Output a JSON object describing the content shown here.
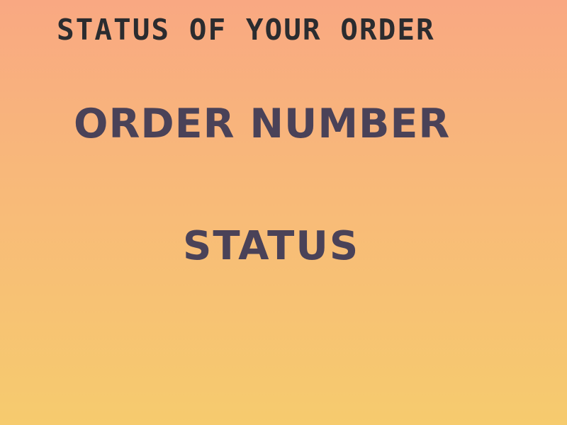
{
  "page": {
    "title": "STATUS OF YOUR ORDER",
    "order_number_label": "ORDER NUMBER",
    "status_label": "STATUS"
  },
  "colors": {
    "background_top": "#f9a882",
    "background_bottom": "#f6cb6e",
    "title_text": "#2b2c2f",
    "label_text": "#4a4258"
  }
}
